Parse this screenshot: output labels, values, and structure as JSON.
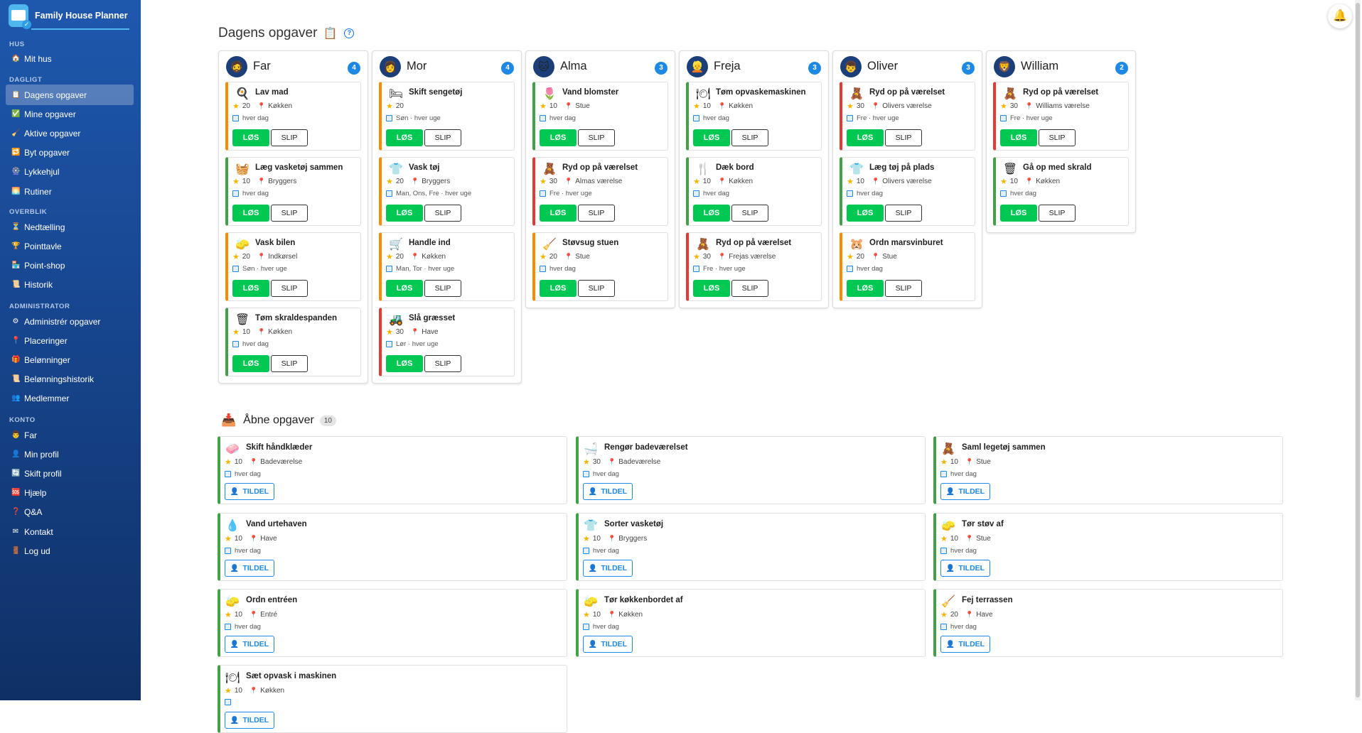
{
  "sidebar": {
    "title": "Family House Planner",
    "sections": [
      {
        "label": "HUS",
        "items": [
          {
            "label": "Mit hus",
            "icon": "🏠"
          }
        ]
      },
      {
        "label": "DAGLIGT",
        "items": [
          {
            "label": "Dagens opgaver",
            "icon": "📋"
          },
          {
            "label": "Mine opgaver",
            "icon": "✅"
          },
          {
            "label": "Aktive opgaver",
            "icon": "🧹"
          },
          {
            "label": "Byt opgaver",
            "icon": "🔁"
          },
          {
            "label": "Lykkehjul",
            "icon": "🎡"
          },
          {
            "label": "Rutiner",
            "icon": "🌅"
          }
        ]
      },
      {
        "label": "OVERBLIK",
        "items": [
          {
            "label": "Nedtælling",
            "icon": "⏳"
          },
          {
            "label": "Pointtavle",
            "icon": "🏆"
          },
          {
            "label": "Point-shop",
            "icon": "🏪"
          },
          {
            "label": "Historik",
            "icon": "📜"
          }
        ]
      },
      {
        "label": "ADMINISTRATOR",
        "items": [
          {
            "label": "Administrér opgaver",
            "icon": "⚙"
          },
          {
            "label": "Placeringer",
            "icon": "📍"
          },
          {
            "label": "Belønninger",
            "icon": "🎁"
          },
          {
            "label": "Belønningshistorik",
            "icon": "📜"
          },
          {
            "label": "Medlemmer",
            "icon": "👥"
          }
        ]
      },
      {
        "label": "KONTO",
        "items": [
          {
            "label": "Far",
            "icon": "👨"
          },
          {
            "label": "Min profil",
            "icon": "👤"
          },
          {
            "label": "Skift profil",
            "icon": "🔄"
          },
          {
            "label": "Hjælp",
            "icon": "🆘"
          },
          {
            "label": "Q&A",
            "icon": "❓"
          },
          {
            "label": "Kontakt",
            "icon": "✉"
          },
          {
            "label": "Log ud",
            "icon": "🚪"
          }
        ]
      }
    ],
    "active_item": "Dagens opgaver"
  },
  "today": {
    "title": "Dagens opgaver",
    "title_icon": "📋",
    "help_icon": "?",
    "members": [
      {
        "name": "Far",
        "avatar": "🧔",
        "count": "4",
        "tasks": [
          {
            "title": "Lav mad",
            "icon": "🍳",
            "points": "20",
            "location": "Køkken",
            "freq": "hver dag",
            "color": "orange"
          },
          {
            "title": "Læg vasketøj sammen",
            "icon": "🧺",
            "points": "10",
            "location": "Bryggers",
            "freq": "hver dag",
            "color": "green"
          },
          {
            "title": "Vask bilen",
            "icon": "🧽",
            "points": "20",
            "location": "Indkørsel",
            "freq": "Søn · hver uge",
            "color": "orange"
          },
          {
            "title": "Tøm skraldespanden",
            "icon": "🗑",
            "points": "10",
            "location": "Køkken",
            "freq": "hver dag",
            "color": "green"
          }
        ]
      },
      {
        "name": "Mor",
        "avatar": "👩",
        "count": "4",
        "tasks": [
          {
            "title": "Skift sengetøj",
            "icon": "🛏",
            "points": "20",
            "location": "",
            "freq": "Søn · hver uge",
            "color": "orange"
          },
          {
            "title": "Vask tøj",
            "icon": "👕",
            "points": "20",
            "location": "Bryggers",
            "freq": "Man, Ons, Fre · hver uge",
            "color": "orange"
          },
          {
            "title": "Handle ind",
            "icon": "🛒",
            "points": "20",
            "location": "Køkken",
            "freq": "Man, Tor · hver uge",
            "color": "orange"
          },
          {
            "title": "Slå græsset",
            "icon": "🚜",
            "points": "30",
            "location": "Have",
            "freq": "Lør · hver uge",
            "color": "red"
          }
        ]
      },
      {
        "name": "Alma",
        "avatar": "🐱",
        "count": "3",
        "tasks": [
          {
            "title": "Vand blomster",
            "icon": "🌷",
            "points": "10",
            "location": "Stue",
            "freq": "hver dag",
            "color": "green"
          },
          {
            "title": "Ryd op på værelset",
            "icon": "🧸",
            "points": "30",
            "location": "Almas værelse",
            "freq": "Fre · hver uge",
            "color": "red"
          },
          {
            "title": "Støvsug stuen",
            "icon": "🧹",
            "points": "20",
            "location": "Stue",
            "freq": "hver dag",
            "color": "orange"
          }
        ]
      },
      {
        "name": "Freja",
        "avatar": "👱",
        "count": "3",
        "tasks": [
          {
            "title": "Tøm opvaskemaskinen",
            "icon": "🍽",
            "points": "10",
            "location": "Køkken",
            "freq": "hver dag",
            "color": "green"
          },
          {
            "title": "Dæk bord",
            "icon": "🍴",
            "points": "10",
            "location": "Køkken",
            "freq": "hver dag",
            "color": "green"
          },
          {
            "title": "Ryd op på værelset",
            "icon": "🧸",
            "points": "30",
            "location": "Frejas værelse",
            "freq": "Fre · hver uge",
            "color": "red"
          }
        ]
      },
      {
        "name": "Oliver",
        "avatar": "👦",
        "count": "3",
        "tasks": [
          {
            "title": "Ryd op på værelset",
            "icon": "🧸",
            "points": "30",
            "location": "Olivers værelse",
            "freq": "Fre · hver uge",
            "color": "red"
          },
          {
            "title": "Læg tøj på plads",
            "icon": "👕",
            "points": "10",
            "location": "Olivers værelse",
            "freq": "hver dag",
            "color": "green"
          },
          {
            "title": "Ordn marsvinburet",
            "icon": "🐹",
            "points": "20",
            "location": "Stue",
            "freq": "hver dag",
            "color": "orange"
          }
        ]
      },
      {
        "name": "William",
        "avatar": "🦁",
        "count": "2",
        "tasks": [
          {
            "title": "Ryd op på værelset",
            "icon": "🧸",
            "points": "30",
            "location": "Williams værelse",
            "freq": "Fre · hver uge",
            "color": "red"
          },
          {
            "title": "Gå op med skrald",
            "icon": "🗑",
            "points": "10",
            "location": "Køkken",
            "freq": "hver dag",
            "color": "green"
          }
        ]
      }
    ],
    "solve_label": "LØS",
    "skip_label": "SLIP"
  },
  "open_tasks": {
    "title": "Åbne opgaver",
    "icon": "📥",
    "count": "10",
    "assign_label": "TILDEL",
    "tasks": [
      {
        "title": "Skift håndklæder",
        "icon": "🧼",
        "points": "10",
        "location": "Badeværelse",
        "freq": "hver dag",
        "color": "green"
      },
      {
        "title": "Rengør badeværelset",
        "icon": "🛁",
        "points": "30",
        "location": "Badeværelse",
        "freq": "hver dag",
        "color": "red"
      },
      {
        "title": "Saml legetøj sammen",
        "icon": "🧸",
        "points": "10",
        "location": "Stue",
        "freq": "hver dag",
        "color": "green"
      },
      {
        "title": "Vand urtehaven",
        "icon": "💧",
        "points": "10",
        "location": "Have",
        "freq": "hver dag",
        "color": "green"
      },
      {
        "title": "Sorter vasketøj",
        "icon": "👕",
        "points": "10",
        "location": "Bryggers",
        "freq": "hver dag",
        "color": "green"
      },
      {
        "title": "Tør støv af",
        "icon": "🧽",
        "points": "10",
        "location": "Stue",
        "freq": "hver dag",
        "color": "green"
      },
      {
        "title": "Ordn entréen",
        "icon": "🧽",
        "points": "10",
        "location": "Entré",
        "freq": "hver dag",
        "color": "green"
      },
      {
        "title": "Tør køkkenbordet af",
        "icon": "🧽",
        "points": "10",
        "location": "Køkken",
        "freq": "hver dag",
        "color": "green"
      },
      {
        "title": "Fej terrassen",
        "icon": "🧹",
        "points": "20",
        "location": "Have",
        "freq": "hver dag",
        "color": "orange"
      },
      {
        "title": "Sæt opvask i maskinen",
        "icon": "🍽",
        "points": "10",
        "location": "Køkken",
        "freq": "",
        "color": "green"
      }
    ]
  },
  "notifications_icon": "🔔"
}
